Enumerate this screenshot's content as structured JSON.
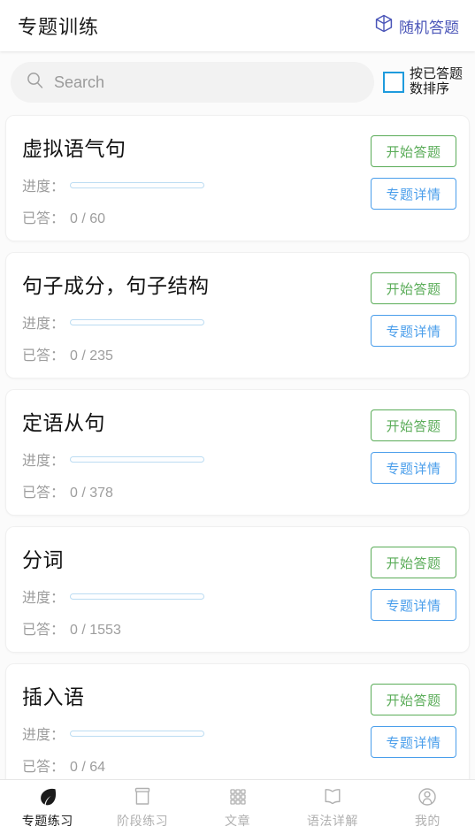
{
  "header": {
    "title": "专题训练",
    "action_label": "随机答题",
    "action_icon": "cube-icon",
    "accent_color": "#4a55b8"
  },
  "search": {
    "placeholder": "Search",
    "value": "",
    "icon": "search-icon"
  },
  "sort": {
    "label": "按已答题数排序",
    "checked": false,
    "checkbox_color": "#1e9bdd"
  },
  "labels": {
    "progress": "进度：",
    "answered": "已答：",
    "start_button": "开始答题",
    "detail_button": "专题详情"
  },
  "colors": {
    "start_button": "#5aac58",
    "detail_button": "#4a9eeb",
    "progress_track": "#bcdcf2",
    "background": "#fbfbfb",
    "card": "#ffffff"
  },
  "topics": [
    {
      "title": "虚拟语气句",
      "answered": "0 / 60",
      "progress_percent": 0,
      "start_label": "开始答题",
      "detail_label": "专题详情"
    },
    {
      "title": "句子成分，句子结构",
      "answered": "0 / 235",
      "progress_percent": 0,
      "start_label": "开始答题",
      "detail_label": "专题详情"
    },
    {
      "title": "定语从句",
      "answered": "0 / 378",
      "progress_percent": 0,
      "start_label": "开始答题",
      "detail_label": "专题详情"
    },
    {
      "title": "分词",
      "answered": "0 / 1553",
      "progress_percent": 0,
      "start_label": "开始答题",
      "detail_label": "专题详情"
    },
    {
      "title": "插入语",
      "answered": "0 / 64",
      "progress_percent": 0,
      "start_label": "开始答题",
      "detail_label": "专题详情"
    }
  ],
  "bottom_nav": {
    "active_index": 0,
    "items": [
      {
        "label": "专题练习",
        "icon": "leaf-icon"
      },
      {
        "label": "阶段练习",
        "icon": "box-icon"
      },
      {
        "label": "文章",
        "icon": "grid-icon"
      },
      {
        "label": "语法详解",
        "icon": "book-icon"
      },
      {
        "label": "我的",
        "icon": "person-icon"
      }
    ]
  }
}
